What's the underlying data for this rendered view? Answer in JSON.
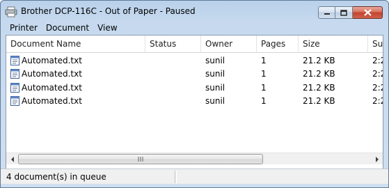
{
  "window": {
    "title": "Brother DCP-116C - Out of Paper - Paused"
  },
  "menu": {
    "items": [
      "Printer",
      "Document",
      "View"
    ]
  },
  "table": {
    "columns": [
      "Document Name",
      "Status",
      "Owner",
      "Pages",
      "Size",
      "Sub"
    ],
    "rows": [
      {
        "name": "Automated.txt",
        "status": "",
        "owner": "sunil",
        "pages": "1",
        "size": "21.2 KB",
        "sub": "2:2"
      },
      {
        "name": "Automated.txt",
        "status": "",
        "owner": "sunil",
        "pages": "1",
        "size": "21.2 KB",
        "sub": "2:2"
      },
      {
        "name": "Automated.txt",
        "status": "",
        "owner": "sunil",
        "pages": "1",
        "size": "21.2 KB",
        "sub": "2:2"
      },
      {
        "name": "Automated.txt",
        "status": "",
        "owner": "sunil",
        "pages": "1",
        "size": "21.2 KB",
        "sub": "2:2"
      }
    ]
  },
  "statusbar": {
    "text": "4 document(s) in queue"
  },
  "icons": {
    "app": "printer-icon",
    "document": "text-document-icon",
    "minimize": "minimize-icon",
    "maximize": "maximize-icon",
    "close": "close-icon"
  }
}
